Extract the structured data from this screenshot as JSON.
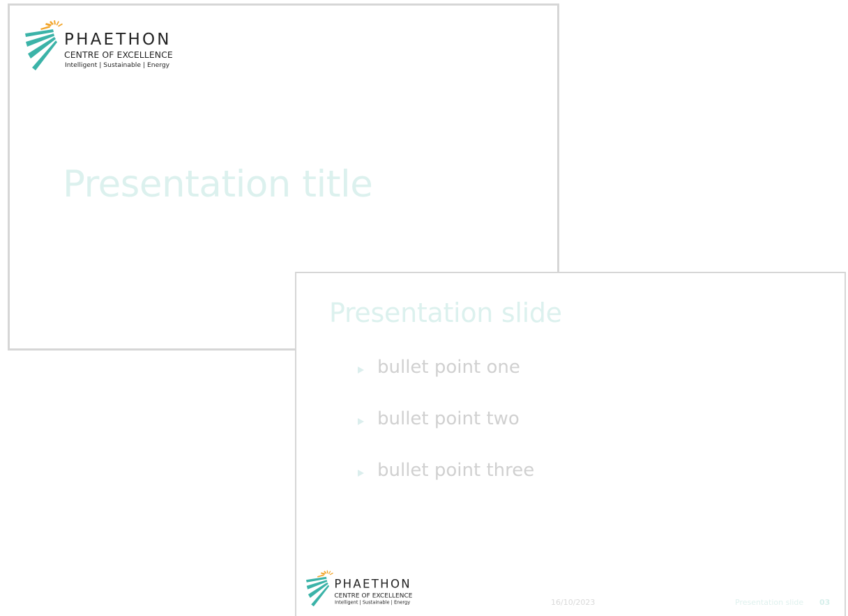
{
  "brand": {
    "name": "PHAETHON",
    "subtitle": "CENTRE OF EXCELLENCE",
    "tagline": "Intelligent | Sustainable | Energy",
    "colors": {
      "teal": "#3bb3a8",
      "orange": "#f2a52b",
      "text": "#222222"
    },
    "mark_icon": "sunburst-logo-icon"
  },
  "title_slide": {
    "title": "Presentation title"
  },
  "content_slide": {
    "heading": "Presentation slide",
    "bullets": [
      {
        "text": "bullet point one"
      },
      {
        "text": "bullet point two"
      },
      {
        "text": "bullet point three"
      }
    ],
    "footer": {
      "date": "16/10/2023",
      "label": "Presentation slide",
      "page_number": "03"
    }
  }
}
